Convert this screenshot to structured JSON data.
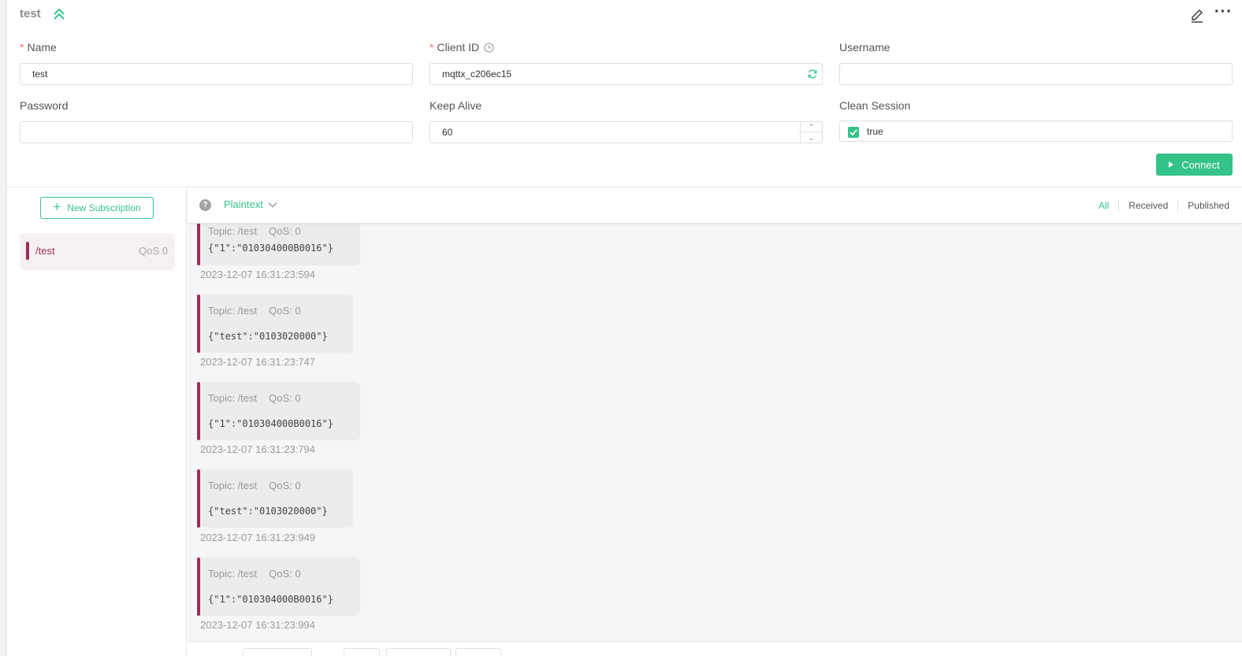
{
  "header": {
    "title": "test",
    "collapse_icon": "chevrons-up-icon",
    "edit_icon": "edit-icon",
    "more_icon": "more-icon",
    "more_label": "···"
  },
  "form": {
    "name": {
      "label": "Name",
      "required_mark": "*",
      "value": "test"
    },
    "client_id": {
      "label": "Client ID",
      "required_mark": "*",
      "value": "mqttx_c206ec15"
    },
    "username": {
      "label": "Username",
      "value": ""
    },
    "password": {
      "label": "Password",
      "value": ""
    },
    "keep_alive": {
      "label": "Keep Alive",
      "value": "60"
    },
    "clean_session": {
      "label": "Clean Session",
      "value": "true",
      "checked": true
    },
    "connect_label": "Connect"
  },
  "subscriptions": {
    "new_button_label": "New Subscription",
    "items": [
      {
        "topic": "/test",
        "qos": "QoS 0",
        "color": "#9b2c58"
      }
    ]
  },
  "messages_toolbar": {
    "help_label": "?",
    "format": "Plaintext",
    "filters": [
      "All",
      "Received",
      "Published"
    ],
    "active_filter": "All"
  },
  "messages": [
    {
      "topic": "Topic: /test",
      "qos": "QoS: 0",
      "payload": "{\"1\":\"010304000B0016\"}",
      "time": "2023-12-07 16:31:23:594"
    },
    {
      "topic": "Topic: /test",
      "qos": "QoS: 0",
      "payload": "{\"test\":\"0103020000\"}",
      "time": "2023-12-07 16:31:23:747"
    },
    {
      "topic": "Topic: /test",
      "qos": "QoS: 0",
      "payload": "{\"1\":\"010304000B0016\"}",
      "time": "2023-12-07 16:31:23:794"
    },
    {
      "topic": "Topic: /test",
      "qos": "QoS: 0",
      "payload": "{\"test\":\"0103020000\"}",
      "time": "2023-12-07 16:31:23:949"
    },
    {
      "topic": "Topic: /test",
      "qos": "QoS: 0",
      "payload": "{\"1\":\"010304000B0016\"}",
      "time": "2023-12-07 16:31:23:994"
    }
  ],
  "colors": {
    "accent": "#34c388",
    "topic": "#9b2c58",
    "required": "#f56c6c"
  }
}
